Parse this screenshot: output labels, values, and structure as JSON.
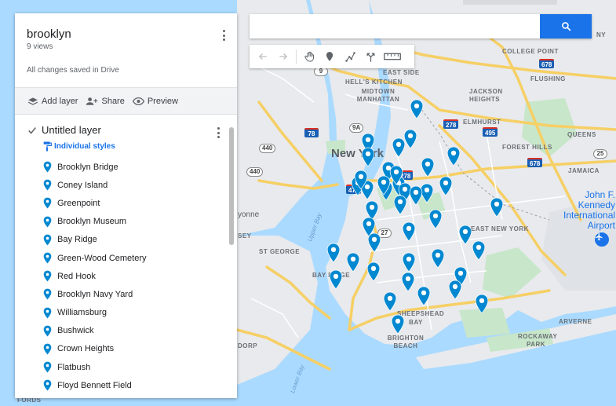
{
  "panel": {
    "title": "brooklyn",
    "views": "9 views",
    "save_status": "All changes saved in Drive",
    "actions": {
      "add_layer": "Add layer",
      "share": "Share",
      "preview": "Preview"
    },
    "layer": {
      "name": "Untitled layer",
      "checked": true,
      "style_link": "Individual styles",
      "places": [
        "Brooklyn Bridge",
        "Coney Island",
        "Greenpoint",
        "Brooklyn Museum",
        "Bay Ridge",
        "Green-Wood Cemetery",
        "Red Hook",
        "Brooklyn Navy Yard",
        "Williamsburg",
        "Bushwick",
        "Crown Heights",
        "Flatbush",
        "Floyd Bennett Field"
      ]
    }
  },
  "search": {
    "value": "",
    "button_icon": "search-icon"
  },
  "toolbar": {
    "tools": [
      "undo-icon",
      "redo-icon",
      "hand-icon",
      "marker-icon",
      "draw-line-icon",
      "directions-icon",
      "ruler-icon"
    ]
  },
  "map": {
    "labels": {
      "new_york": "New York",
      "queens": "QUEENS",
      "jamaica": "JAMAICA",
      "flushing": "FLUSHING",
      "college_point": "COLLEGE POINT",
      "elmhurst": "ELMHURST",
      "forest_hills": "FOREST HILLS",
      "jackson_heights": "JACKSON HEIGHTS",
      "hells_kitchen": "HELL'S KITCHEN",
      "midtown": "MIDTOWN MANHATTAN",
      "east_side": "EAST SIDE",
      "east_new_york": "EAST NEW YORK",
      "bay_ridge": "BAY RIDGE",
      "st_george": "ST GEORGE",
      "sheepshead_bay": "SHEEPSHEAD BAY",
      "brighton_beach": "BRIGHTON BEACH",
      "rockaway_park": "ROCKAWAY PARK",
      "arverne": "ARVERNE",
      "dorp": "DORP",
      "fords": "FORDS",
      "yonne": "yonne",
      "sey": "SEY",
      "upper_bay": "Upper Bay",
      "lower_bay": "Lower Bay",
      "jfk": "John F. Kennedy International Airport",
      "ny_edge": "NY"
    },
    "shields": [
      "9",
      "495",
      "278",
      "78",
      "440",
      "440",
      "278",
      "478",
      "27",
      "9A",
      "678",
      "25",
      "678",
      "25"
    ],
    "accent_color": "#1a73e8",
    "pin_color": "#0288d1",
    "pin_count": 41
  }
}
